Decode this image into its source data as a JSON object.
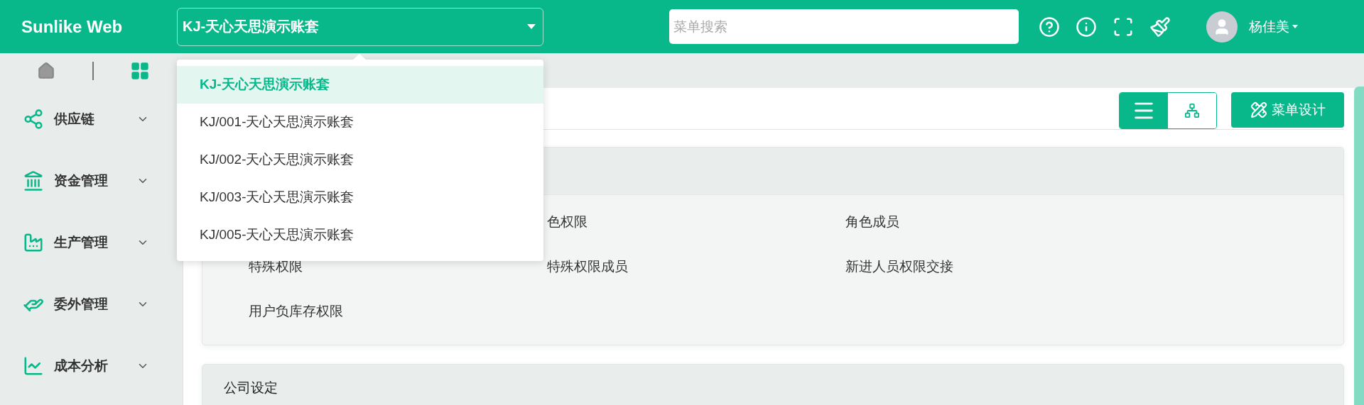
{
  "header": {
    "logo": "Sunlike Web",
    "company_select": {
      "value": "KJ-天心天思演示账套",
      "options": [
        {
          "label": "KJ-天心天思演示账套",
          "selected": true
        },
        {
          "label": "KJ/001-天心天思演示账套",
          "selected": false
        },
        {
          "label": "KJ/002-天心天思演示账套",
          "selected": false
        },
        {
          "label": "KJ/003-天心天思演示账套",
          "selected": false
        },
        {
          "label": "KJ/005-天心天思演示账套",
          "selected": false
        }
      ]
    },
    "search": {
      "placeholder": "菜单搜索"
    },
    "user": {
      "name": "杨佳美"
    }
  },
  "sidebar": {
    "items": [
      {
        "label": "供应链",
        "kind": "nodes",
        "expanded": false
      },
      {
        "label": "资金管理",
        "kind": "bank",
        "expanded": false
      },
      {
        "label": "生产管理",
        "kind": "robot",
        "expanded": false
      },
      {
        "label": "委外管理",
        "kind": "hand",
        "expanded": false
      },
      {
        "label": "成本分析",
        "kind": "chart",
        "expanded": false
      }
    ]
  },
  "toolbar": {
    "views": [
      {
        "kind": "list",
        "selected": true
      },
      {
        "kind": "tree",
        "selected": false
      }
    ],
    "design_button": "菜单设计"
  },
  "cards": [
    {
      "items": [
        {
          "label": "色权限",
          "kind": "middle"
        },
        {
          "label": "角色成员",
          "kind": "right"
        },
        {
          "label": "特殊权限",
          "kind": "left"
        },
        {
          "label": "特殊权限成员",
          "kind": "middle"
        },
        {
          "label": "新进人员权限交接",
          "kind": "right"
        },
        {
          "label": "用户负库存权限",
          "kind": "left"
        }
      ]
    },
    {
      "title": "公司设定"
    }
  ]
}
